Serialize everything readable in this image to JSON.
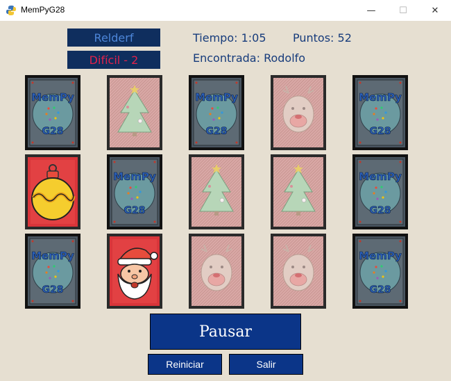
{
  "window": {
    "title": "MemPyG28",
    "minimize": "—",
    "maximize": "☐",
    "close": "✕"
  },
  "header": {
    "player": "Relderf",
    "level": "Difícil - 2",
    "time": "Tiempo: 1:05",
    "points": "Puntos: 52",
    "found": "Encontrada: Rodolfo"
  },
  "card_back": {
    "logo_top": "MemPy",
    "logo_bottom": "G28"
  },
  "board": [
    [
      "back",
      "tree-faded",
      "back",
      "reindeer-faded",
      "back"
    ],
    [
      "ornament",
      "back",
      "tree-faded",
      "tree-faded",
      "back"
    ],
    [
      "back",
      "santa",
      "reindeer-faded",
      "reindeer-faded",
      "back"
    ]
  ],
  "buttons": {
    "pause": "Pausar",
    "restart": "Reiniciar",
    "exit": "Salir"
  },
  "colors": {
    "background": "#e6dfd1",
    "button": "#0b3588",
    "label_bg": "#0f2e5e",
    "player_text": "#4d86d9",
    "level_text": "#e0224b",
    "info_text": "#163b7b"
  }
}
